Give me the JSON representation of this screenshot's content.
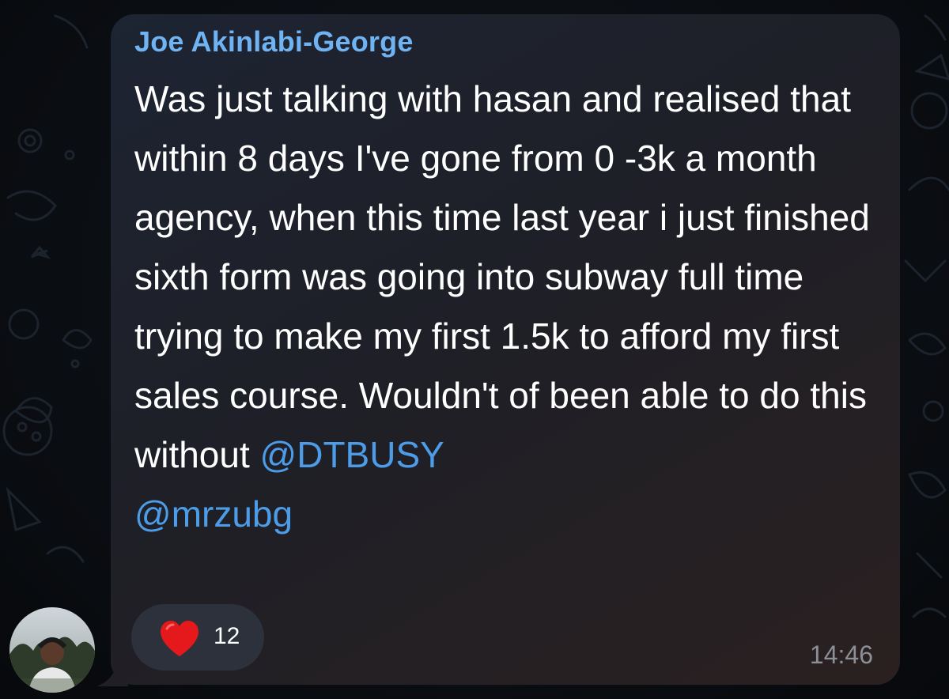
{
  "message": {
    "sender": "Joe Akinlabi-George",
    "text": "Was just talking with hasan and realised that within 8 days I've gone from 0 -3k a month agency, when this time last year i just finished sixth form was going into subway full time trying to make my first 1.5k to afford my first sales course. Wouldn't of been able to do this without ",
    "mentions": [
      "@DTBUSY",
      "@mrzubg"
    ],
    "time": "14:46",
    "reaction": {
      "icon": "heart-icon",
      "count": "12"
    }
  },
  "colors": {
    "sender_name": "#6fb3f2",
    "mention": "#4c9ce8",
    "heart": "#e5181b",
    "time": "#8c8f96"
  }
}
